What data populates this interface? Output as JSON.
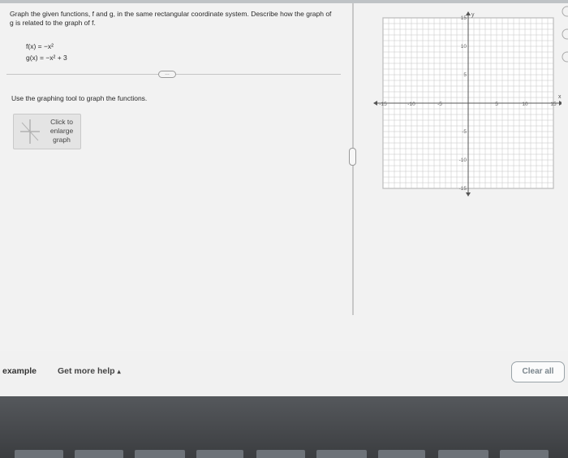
{
  "question": {
    "text": "Graph the given functions, f and g, in the same rectangular coordinate system. Describe how the graph of g is related to the graph of f.",
    "f_label": "f(x) = −x²",
    "g_label": "g(x) = −x² + 3"
  },
  "more_button": {
    "label": "…"
  },
  "instruction": "Use the graphing tool to graph the functions.",
  "enlarge": {
    "line1": "Click to",
    "line2": "enlarge",
    "line3": "graph"
  },
  "graph": {
    "x_range": [
      -15,
      15
    ],
    "y_range": [
      -15,
      15
    ],
    "x_axis_label": "x",
    "y_axis_label": "y",
    "x_ticks": [
      "-15",
      "-10",
      "-5",
      "5",
      "10",
      "15"
    ],
    "y_ticks": [
      "15",
      "10",
      "5",
      "-5",
      "-10",
      "-15"
    ],
    "grid": true
  },
  "footer": {
    "example": "example",
    "help": "Get more help",
    "help_caret": "▴",
    "clear": "Clear all"
  }
}
